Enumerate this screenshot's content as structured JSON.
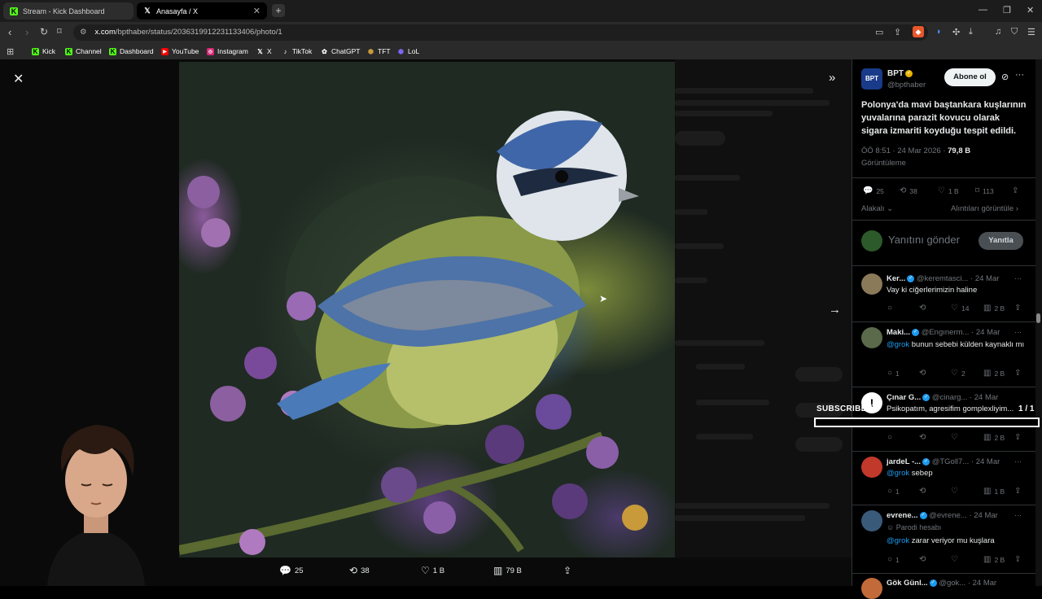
{
  "tabs": [
    {
      "label": "Stream - Kick Dashboard",
      "icon": "kick-icon"
    },
    {
      "label": "Anasayfa / X",
      "icon": "x-logo-icon"
    }
  ],
  "address": {
    "host": "x.com",
    "path": "/bpthaber/status/2036319912231133406/photo/1"
  },
  "bookmarks": [
    {
      "label": "Kick",
      "icon": "kick-icon",
      "color": "#53fc18"
    },
    {
      "label": "Channel",
      "icon": "kick-icon",
      "color": "#53fc18"
    },
    {
      "label": "Dashboard",
      "icon": "kick-icon",
      "color": "#53fc18"
    },
    {
      "label": "YouTube",
      "icon": "youtube-icon",
      "color": "#ff0000"
    },
    {
      "label": "Instagram",
      "icon": "instagram-icon",
      "color": "#d62976"
    },
    {
      "label": "X",
      "icon": "x-logo-icon",
      "color": "#ffffff"
    },
    {
      "label": "TikTok",
      "icon": "tiktok-icon",
      "color": "#ffffff"
    },
    {
      "label": "ChatGPT",
      "icon": "chatgpt-icon",
      "color": "#ffffff"
    },
    {
      "label": "TFT",
      "icon": "tft-icon",
      "color": "#c89b3c"
    },
    {
      "label": "LoL",
      "icon": "lol-icon",
      "color": "#7b68ee"
    }
  ],
  "photo_bar": {
    "replies": "25",
    "reposts": "38",
    "likes": "1 B",
    "views": "79 B"
  },
  "post": {
    "author_name": "BPT",
    "author_handle": "@bpthaber",
    "avatar_text": "BPT",
    "follow_label": "Abone ol",
    "text": "Polonya'da mavi baştankara kuşlarının yuvalarına parazit kovucu olarak sigara izmariti koyduğu tespit edildi.",
    "timestamp": "ÖÖ 8:51 · 24 Mar 2026 ·",
    "views_count": "79,8 B",
    "views_label": "Görüntüleme",
    "replies": "25",
    "reposts": "38",
    "likes": "1 B",
    "bookmarks": "113",
    "sort_label": "Alakalı",
    "quotes_label": "Alıntıları görüntüle",
    "reply_placeholder": "Yanıtını gönder",
    "reply_button": "Yanıtla"
  },
  "replies": [
    {
      "name": "Ker...",
      "handle": "@keremtasci...",
      "date": "· 24 Mar",
      "text": "Vay ki ciğerlerimizin haline",
      "comments": "",
      "reposts": "",
      "likes": "14",
      "views": "2 B",
      "avatar_color": "#8a7a5a"
    },
    {
      "name": "Maki...",
      "handle": "@Engınerm...",
      "date": "· 24 Mar",
      "mention": "@grok",
      "text": " bunun sebebi külden kaynaklı mı",
      "comments": "1",
      "reposts": "",
      "likes": "2",
      "views": "2 B",
      "avatar_color": "#5a6a4a"
    },
    {
      "name": "Çınar G...",
      "handle": "@cinarg...",
      "date": "· 24 Mar",
      "text": "Psikopatım, agresifim gomplexliyim...",
      "comments": "",
      "reposts": "",
      "likes": "",
      "views": "2 B",
      "avatar_color": "#ffffff"
    },
    {
      "name": "jardeL -...",
      "handle": "@TGoll7...",
      "date": "· 24 Mar",
      "mention": "@grok",
      "text": " sebep",
      "comments": "1",
      "reposts": "",
      "likes": "",
      "views": "1 B",
      "avatar_color": "#c0392b"
    },
    {
      "name": "evrene...",
      "handle": "@evrene...",
      "date": "· 24 Mar",
      "badge": "Parodi hesabı",
      "mention": "@grok",
      "text": " zarar veriyor mu kuşlara",
      "comments": "1",
      "reposts": "",
      "likes": "",
      "views": "2 B",
      "avatar_color": "#3a5a7a"
    },
    {
      "name": "Gök Günl...",
      "handle": "@gok...",
      "date": "· 24 Mar",
      "avatar_color": "#c26a3a"
    }
  ],
  "overlay": {
    "subscribers_label": "SUBSCRIBERS",
    "subscribers_count": "1 / 1"
  }
}
